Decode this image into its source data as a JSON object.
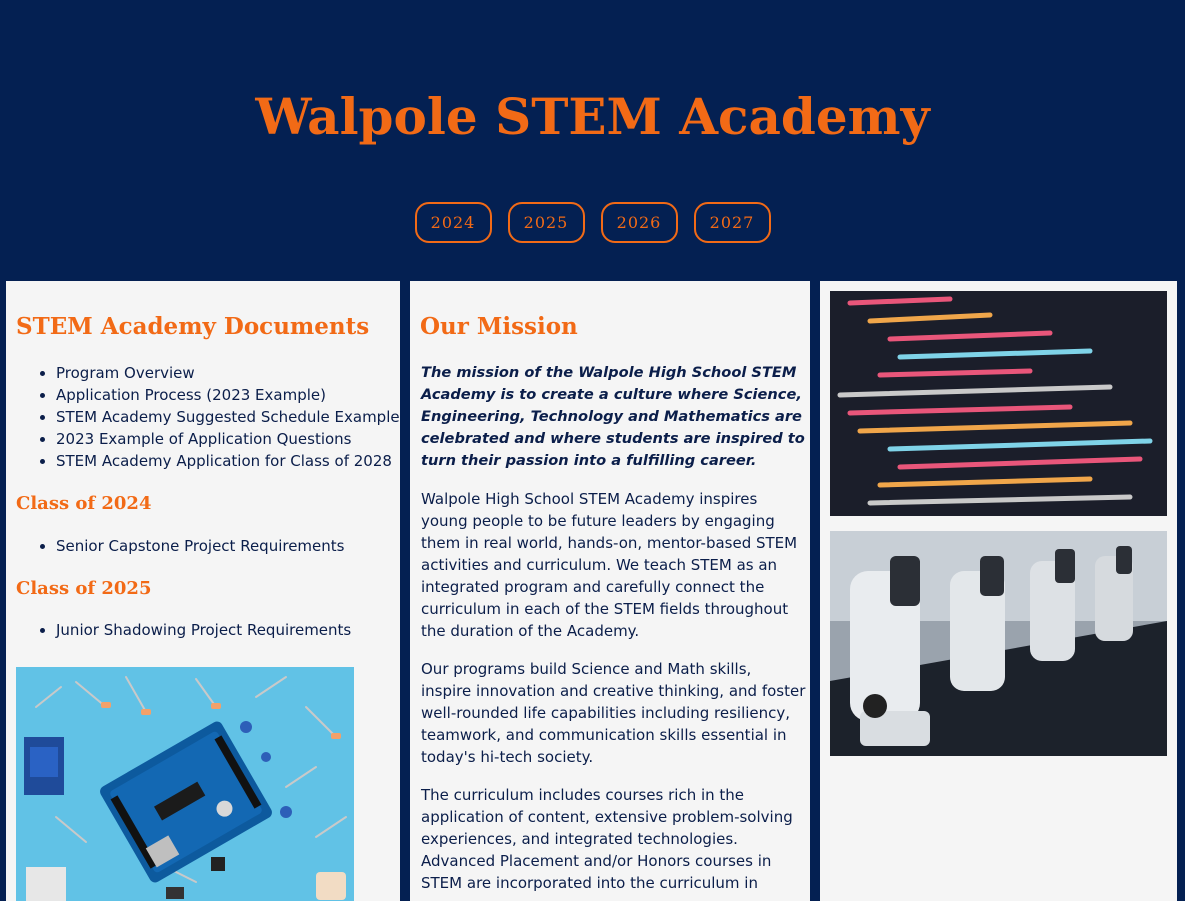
{
  "header": {
    "title": "Walpole STEM Academy",
    "years": [
      "2024",
      "2025",
      "2026",
      "2027"
    ]
  },
  "documents": {
    "heading": "STEM Academy Documents",
    "items": [
      "Program Overview",
      "Application Process (2023 Example)",
      "STEM Academy Suggested Schedule Example",
      "2023 Example of Application Questions",
      "STEM Academy Application for Class of 2028"
    ],
    "class2024": {
      "heading": "Class of 2024",
      "items": [
        "Senior Capstone Project Requirements"
      ]
    },
    "class2025": {
      "heading": "Class of 2025",
      "items": [
        "Junior Shadowing Project Requirements"
      ]
    }
  },
  "mission": {
    "heading": "Our Mission",
    "statement": "The mission of the Walpole High School STEM Academy is to create a culture where Science, Engineering, Technology and Mathematics are celebrated and where students are inspired to turn their passion into a fulfilling career.",
    "paragraphs": [
      "Walpole High School STEM Academy inspires young people to be future leaders by engaging them in real world, hands-on, mentor-based STEM activities and curriculum. We teach STEM as an integrated program and carefully connect the curriculum in each of the STEM fields throughout the duration of the Academy.",
      "Our programs build Science and Math skills, inspire innovation and creative thinking, and foster well-rounded life capabilities including resiliency, teamwork, and communication skills essential in today's hi-tech society.",
      "The curriculum includes courses rich in the application of content, extensive problem-solving experiences, and integrated technologies. Advanced Placement and/or Honors courses in STEM are incorporated into the curriculum in"
    ]
  },
  "colors": {
    "background": "#042052",
    "accent": "#f26a16",
    "panel": "#f5f5f5",
    "text": "#0b1e4a"
  },
  "icons": {
    "photo1": "electronics-photo",
    "photo2": "code-photo",
    "photo3": "microscope-photo"
  }
}
